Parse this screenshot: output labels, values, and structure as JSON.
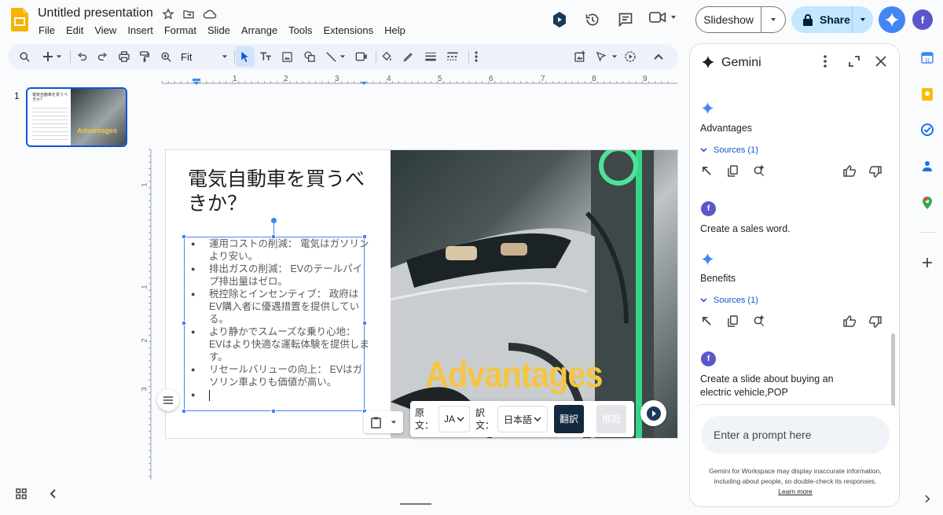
{
  "app": {
    "doc_title": "Untitled presentation",
    "menu": [
      "File",
      "Edit",
      "View",
      "Insert",
      "Format",
      "Slide",
      "Arrange",
      "Tools",
      "Extensions",
      "Help"
    ],
    "slideshow_label": "Slideshow",
    "share_label": "Share",
    "avatar_letter": "f"
  },
  "toolbar": {
    "zoom_label": "Fit"
  },
  "filmstrip": {
    "slide_number": "1",
    "thumb_label": "Advantages"
  },
  "ruler": {
    "h_marks": [
      "1",
      "2",
      "3",
      "4",
      "5",
      "6",
      "7",
      "8",
      "9"
    ],
    "v_marks": [
      "1",
      "1",
      "2",
      "3"
    ]
  },
  "slide": {
    "title": "電気自動車を買うべきか？",
    "bullets": [
      "運用コストの削減： 電気はガソリンより安い。",
      "排出ガスの削減： EVのテールパイプ排出量はゼロ。",
      "税控除とインセンティブ： 政府はEV購入者に優遇措置を提供している。",
      "より静かでスムーズな乗り心地： EVはより快適な運転体験を提供します。",
      "リセールバリューの向上： EVはガソリン車よりも価値が高い。",
      ""
    ],
    "image_caption": "Advantages"
  },
  "translate_bar": {
    "source_label": "原文：",
    "source_value": "JA",
    "target_label": "訳文：",
    "target_value": "日本語",
    "translate_button": "翻訳",
    "refine_button": "推敲"
  },
  "gemini": {
    "title": "Gemini",
    "items": [
      {
        "type": "response",
        "text": "Advantages",
        "sources": "Sources (1)"
      },
      {
        "type": "user",
        "text": "Create a sales word."
      },
      {
        "type": "response",
        "text": "Benefits",
        "sources": "Sources (1)"
      },
      {
        "type": "user",
        "text": "Create a slide about buying an electric vehicle,POP"
      }
    ],
    "prompt_placeholder": "Enter a prompt here",
    "disclaimer": "Gemini for Workspace may display inaccurate information, including about people, so double-check its responses.",
    "learn_more": "Learn more"
  },
  "colors": {
    "accent": "#0b57d0",
    "share_bg": "#c2e7ff",
    "caption_yellow": "#f4c542",
    "gemini_blue": "#4285f4"
  }
}
